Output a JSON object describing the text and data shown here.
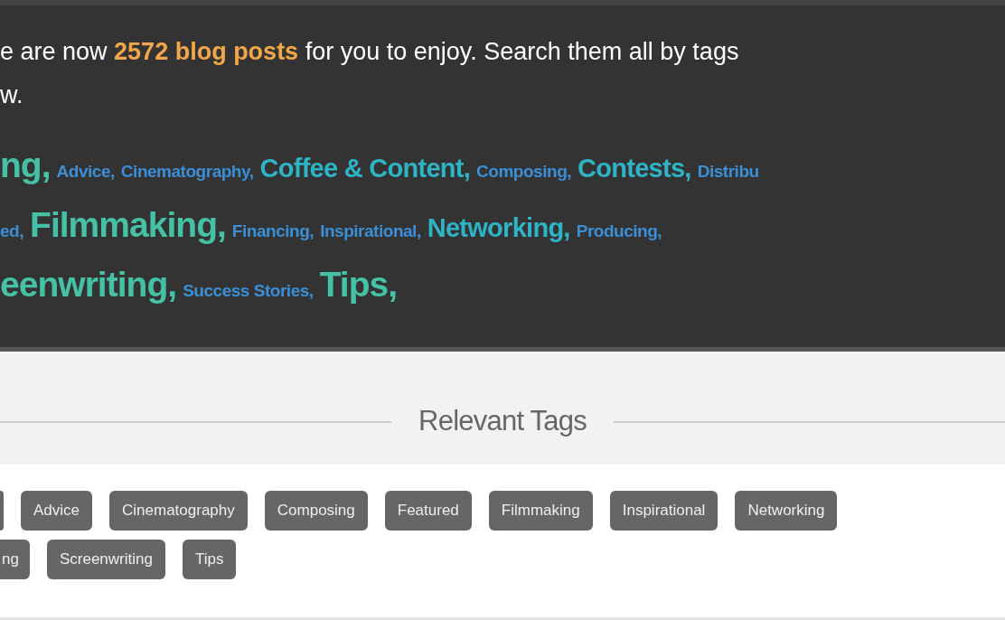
{
  "intro_lines": [
    "e are now **2572 blog posts** for you to enjoy. Search them all by tags",
    "w."
  ],
  "tag_cloud": [
    [
      {
        "label": "ng,",
        "kind": "large"
      },
      {
        "label": "Advice,",
        "kind": "small"
      },
      {
        "label": "Cinematography,",
        "kind": "small"
      },
      {
        "label": "Coffee & Content,",
        "kind": "medium"
      },
      {
        "label": "Composing,",
        "kind": "small"
      },
      {
        "label": "Contests,",
        "kind": "medium"
      },
      {
        "label": "Distribu",
        "kind": "small"
      }
    ],
    [
      {
        "label": "ed,",
        "kind": "small"
      },
      {
        "label": "Filmmaking,",
        "kind": "large"
      },
      {
        "label": "Financing,",
        "kind": "small"
      },
      {
        "label": "Inspirational,",
        "kind": "small"
      },
      {
        "label": "Networking,",
        "kind": "medium"
      },
      {
        "label": "Producing,",
        "kind": "small"
      }
    ],
    [
      {
        "label": "eenwriting,",
        "kind": "large"
      },
      {
        "label": "Success Stories,",
        "kind": "small"
      },
      {
        "label": "Tips,",
        "kind": "large"
      }
    ]
  ],
  "relevant_tags": {
    "title": "Relevant Tags",
    "rows": [
      [
        {
          "kind": "edge"
        },
        {
          "label": "Advice"
        },
        {
          "label": "Cinematography"
        },
        {
          "label": "Composing"
        },
        {
          "label": "Featured"
        },
        {
          "label": "Filmmaking"
        },
        {
          "label": "Inspirational"
        },
        {
          "label": "Networking"
        }
      ],
      [
        {
          "label": "ng",
          "kind": "edge"
        },
        {
          "label": "Screenwriting"
        },
        {
          "label": "Tips"
        }
      ]
    ]
  }
}
